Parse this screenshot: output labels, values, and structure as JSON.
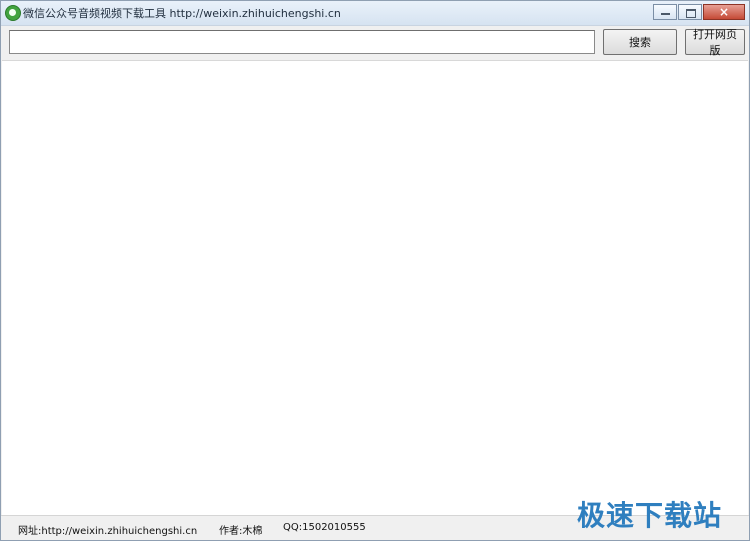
{
  "window": {
    "title": "微信公众号音频视频下载工具 http://weixin.zhihuichengshi.cn"
  },
  "toolbar": {
    "search_value": "",
    "search_button": "搜索",
    "open_webpage_button": "打开网页版"
  },
  "status": {
    "website": "网址:http://weixin.zhihuichengshi.cn",
    "author": "作者:木棉",
    "qq": "QQ:1502010555"
  },
  "watermark": {
    "text": "极速下载站"
  },
  "icons": {
    "app": "app-icon",
    "minimize": "minimize-icon",
    "maximize": "maximize-icon",
    "close": "close-icon"
  },
  "colors": {
    "titlebar": "#d6e3f1",
    "close_button": "#c54a36",
    "watermark": "#2f7fbf"
  }
}
